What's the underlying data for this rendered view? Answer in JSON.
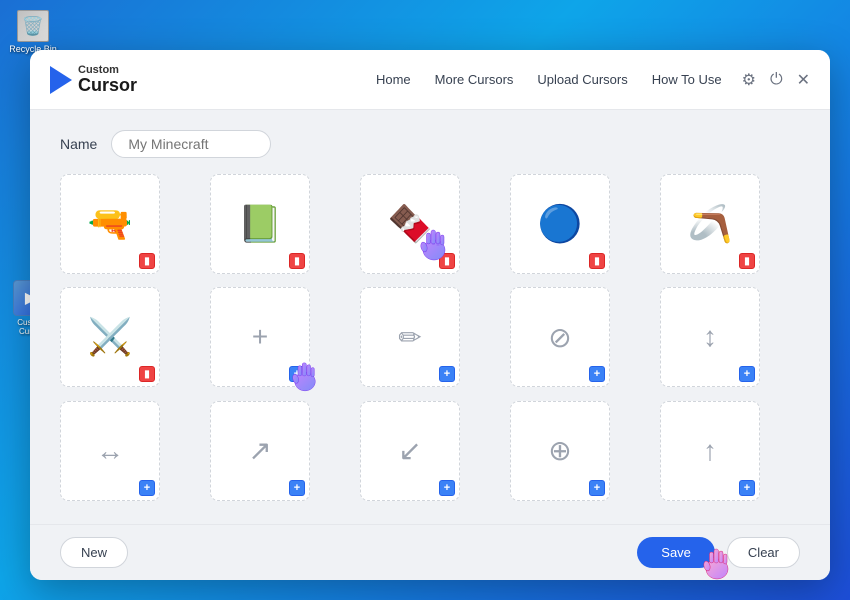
{
  "desktop": {
    "icon1_label": "Recycle Bin",
    "icon2_label": "Custom\nCursor"
  },
  "header": {
    "logo_custom": "Custom",
    "logo_cursor": "Cursor",
    "nav_items": [
      {
        "label": "Home",
        "id": "home"
      },
      {
        "label": "More Cursors",
        "id": "more-cursors"
      },
      {
        "label": "Upload Cursors",
        "id": "upload-cursors"
      },
      {
        "label": "How To Use",
        "id": "how-to-use"
      }
    ],
    "icons": {
      "settings": "⚙",
      "power": "⏻",
      "close": "✕"
    }
  },
  "name_field": {
    "label": "Name",
    "value": "My Minecraft",
    "placeholder": "My Minecraft"
  },
  "grid": {
    "rows": [
      [
        {
          "type": "item",
          "icon": "🔫",
          "action": "delete"
        },
        {
          "type": "item",
          "icon": "📗",
          "action": "delete"
        },
        {
          "type": "item",
          "icon": "🍫",
          "action": "delete",
          "has_cursor": true
        },
        {
          "type": "item",
          "icon": "🔵",
          "action": "delete"
        },
        {
          "type": "item",
          "icon": "🪃",
          "action": "delete"
        }
      ],
      [
        {
          "type": "item",
          "icon": "⚔",
          "action": "delete"
        },
        {
          "type": "empty",
          "icon": "+",
          "action": "add",
          "has_cursor": true
        },
        {
          "type": "empty",
          "icon": "✎",
          "action": "add"
        },
        {
          "type": "empty",
          "icon": "⊘",
          "action": "add"
        },
        {
          "type": "empty",
          "icon": "↕",
          "action": "add"
        }
      ],
      [
        {
          "type": "empty",
          "icon": "↔",
          "action": "add"
        },
        {
          "type": "empty",
          "icon": "↗",
          "action": "add"
        },
        {
          "type": "empty",
          "icon": "↙",
          "action": "add"
        },
        {
          "type": "empty",
          "icon": "⊕",
          "action": "add"
        },
        {
          "type": "empty",
          "icon": "↑",
          "action": "add"
        }
      ]
    ]
  },
  "footer": {
    "new_label": "New",
    "save_label": "Save",
    "clear_label": "Clear"
  }
}
